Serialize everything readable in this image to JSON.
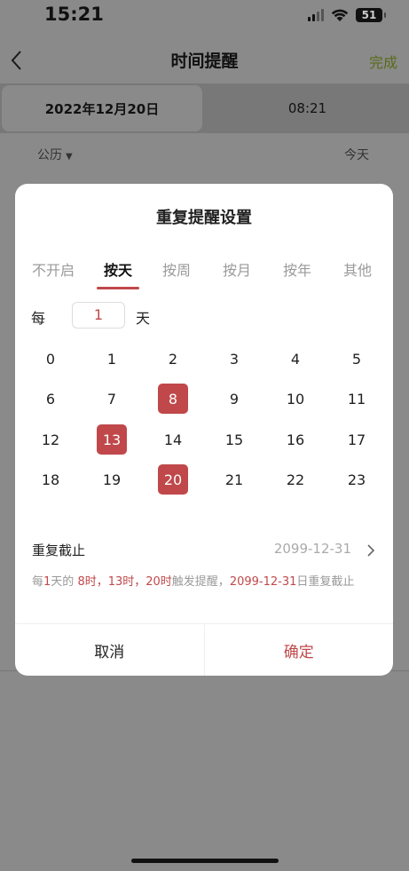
{
  "status_bar": {
    "time": "15:21",
    "battery": "51"
  },
  "nav": {
    "back_icon": "chevron-left-icon",
    "title": "时间提醒",
    "done_label": "完成"
  },
  "date_tabs": {
    "date": "2022年12月20日",
    "time": "08:21"
  },
  "calendar_row": {
    "calendar_type": "公历",
    "today_label": "今天"
  },
  "modal": {
    "title": "重复提醒设置",
    "mode_tabs": [
      {
        "label": "不开启",
        "active": false
      },
      {
        "label": "按天",
        "active": true
      },
      {
        "label": "按周",
        "active": false
      },
      {
        "label": "按月",
        "active": false
      },
      {
        "label": "按年",
        "active": false
      },
      {
        "label": "其他",
        "active": false
      }
    ],
    "every": {
      "prefix": "每",
      "value": "1",
      "unit": "天"
    },
    "hours": [
      "0",
      "1",
      "2",
      "3",
      "4",
      "5",
      "6",
      "7",
      "8",
      "9",
      "10",
      "11",
      "12",
      "13",
      "14",
      "15",
      "16",
      "17",
      "18",
      "19",
      "20",
      "21",
      "22",
      "23"
    ],
    "selected_hours": [
      "8",
      "13",
      "20"
    ],
    "repeat_end": {
      "label": "重复截止",
      "date": "2099-12-31"
    },
    "summary": {
      "p1": "每",
      "h1": "1",
      "p2": "天的 ",
      "h2": "8时，13时，20时",
      "p3": "触发提醒，",
      "h3": "2099-12-31",
      "p4": "日重复截止"
    },
    "cancel_label": "取消",
    "confirm_label": "确定"
  },
  "colors": {
    "accent": "#c0484a",
    "done_text": "#5a6a1a",
    "overlay": "#8a8a8a"
  }
}
